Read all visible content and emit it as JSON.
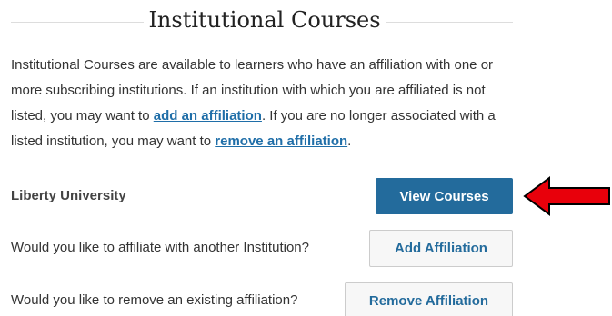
{
  "page": {
    "title": "Institutional Courses"
  },
  "intro": {
    "text_1": "Institutional Courses are available to learners who have an affiliation with one or more subscribing institutions. If an institution with which you are affiliated is not listed, you may want to ",
    "add_link": "add an affiliation",
    "text_2": ". If you are no longer associated with a listed institution, you may want to ",
    "remove_link": "remove an affiliation",
    "text_3": "."
  },
  "institution": {
    "name": "Liberty University",
    "view_button": "View Courses"
  },
  "affiliate": {
    "question": "Would you like to affiliate with another Institution?",
    "button": "Add Affiliation"
  },
  "remove": {
    "question": "Would you like to remove an existing affiliation?",
    "button": "Remove Affiliation"
  },
  "colors": {
    "primary": "#236b9c",
    "link": "#1f6ea8",
    "arrow": "#e8000b"
  },
  "annotation": {
    "icon": "left-arrow-icon"
  }
}
